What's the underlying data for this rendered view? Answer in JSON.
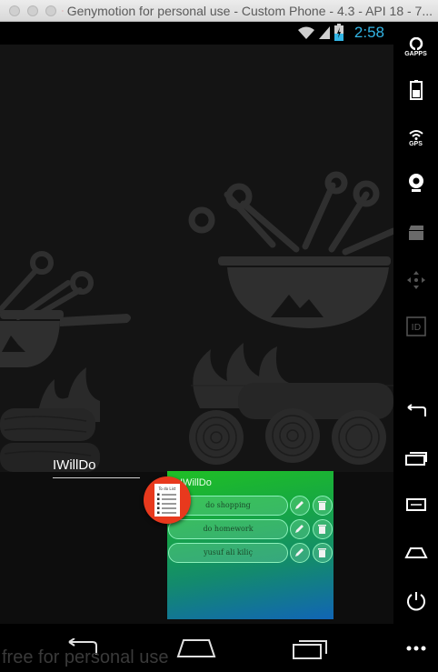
{
  "window": {
    "title": "Genymotion for personal use - Custom Phone - 4.3 - API 18 - 7..."
  },
  "status_bar": {
    "time": "2:58"
  },
  "widget": {
    "label": "IWillDo",
    "panel_title": "IWillDo",
    "tasks": [
      "do shopping",
      "do homework",
      "yusuf ali kiliç"
    ],
    "icon_text": "To do List"
  },
  "watermark": "free for personal use",
  "sidebar": {
    "gapps_label": "GAPPS",
    "gps_label": "GPS",
    "id_label": "ID"
  },
  "colors": {
    "clock": "#33b5e5",
    "icon_red": "#e8391d",
    "panel_top": "#1fbf25",
    "panel_bottom": "#1165b5"
  }
}
